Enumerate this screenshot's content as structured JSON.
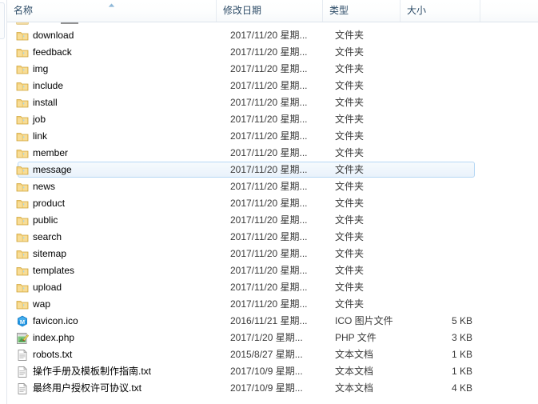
{
  "window": {
    "view_mode": "details-list"
  },
  "columns": [
    {
      "key": "name",
      "label": "名称",
      "sorted": true,
      "sort_direction": "ascending",
      "sort_icon": "sort-ascending-icon"
    },
    {
      "key": "date_modified",
      "label": "修改日期",
      "sorted": false
    },
    {
      "key": "type",
      "label": "类型",
      "sorted": false
    },
    {
      "key": "size",
      "label": "大小",
      "sorted": false
    }
  ],
  "items": [
    {
      "name": "download",
      "date": "2017/11/20 星期...",
      "type": "文件夹",
      "size": "",
      "icon": "folder-icon",
      "selected": false
    },
    {
      "name": "feedback",
      "date": "2017/11/20 星期...",
      "type": "文件夹",
      "size": "",
      "icon": "folder-icon",
      "selected": false
    },
    {
      "name": "img",
      "date": "2017/11/20 星期...",
      "type": "文件夹",
      "size": "",
      "icon": "folder-icon",
      "selected": false
    },
    {
      "name": "include",
      "date": "2017/11/20 星期...",
      "type": "文件夹",
      "size": "",
      "icon": "folder-icon",
      "selected": false
    },
    {
      "name": "install",
      "date": "2017/11/20 星期...",
      "type": "文件夹",
      "size": "",
      "icon": "folder-icon",
      "selected": false
    },
    {
      "name": "job",
      "date": "2017/11/20 星期...",
      "type": "文件夹",
      "size": "",
      "icon": "folder-icon",
      "selected": false
    },
    {
      "name": "link",
      "date": "2017/11/20 星期...",
      "type": "文件夹",
      "size": "",
      "icon": "folder-icon",
      "selected": false
    },
    {
      "name": "member",
      "date": "2017/11/20 星期...",
      "type": "文件夹",
      "size": "",
      "icon": "folder-icon",
      "selected": false
    },
    {
      "name": "message",
      "date": "2017/11/20 星期...",
      "type": "文件夹",
      "size": "",
      "icon": "folder-icon",
      "selected": true
    },
    {
      "name": "news",
      "date": "2017/11/20 星期...",
      "type": "文件夹",
      "size": "",
      "icon": "folder-icon",
      "selected": false
    },
    {
      "name": "product",
      "date": "2017/11/20 星期...",
      "type": "文件夹",
      "size": "",
      "icon": "folder-icon",
      "selected": false
    },
    {
      "name": "public",
      "date": "2017/11/20 星期...",
      "type": "文件夹",
      "size": "",
      "icon": "folder-icon",
      "selected": false
    },
    {
      "name": "search",
      "date": "2017/11/20 星期...",
      "type": "文件夹",
      "size": "",
      "icon": "folder-icon",
      "selected": false
    },
    {
      "name": "sitemap",
      "date": "2017/11/20 星期...",
      "type": "文件夹",
      "size": "",
      "icon": "folder-icon",
      "selected": false
    },
    {
      "name": "templates",
      "date": "2017/11/20 星期...",
      "type": "文件夹",
      "size": "",
      "icon": "folder-icon",
      "selected": false
    },
    {
      "name": "upload",
      "date": "2017/11/20 星期...",
      "type": "文件夹",
      "size": "",
      "icon": "folder-icon",
      "selected": false
    },
    {
      "name": "wap",
      "date": "2017/11/20 星期...",
      "type": "文件夹",
      "size": "",
      "icon": "folder-icon",
      "selected": false
    },
    {
      "name": "favicon.ico",
      "date": "2016/11/21 星期...",
      "type": "ICO 图片文件",
      "size": "5 KB",
      "icon": "ico-image-file-icon",
      "selected": false
    },
    {
      "name": "index.php",
      "date": "2017/1/20 星期...",
      "type": "PHP 文件",
      "size": "3 KB",
      "icon": "php-file-icon",
      "selected": false
    },
    {
      "name": "robots.txt",
      "date": "2015/8/27 星期...",
      "type": "文本文档",
      "size": "1 KB",
      "icon": "text-file-icon",
      "selected": false
    },
    {
      "name": "操作手册及模板制作指南.txt",
      "date": "2017/10/9 星期...",
      "type": "文本文档",
      "size": "1 KB",
      "icon": "text-file-icon",
      "selected": false
    },
    {
      "name": "最终用户授权许可协议.txt",
      "date": "2017/10/9 星期...",
      "type": "文本文档",
      "size": "4 KB",
      "icon": "text-file-icon",
      "selected": false
    }
  ],
  "colors": {
    "header_text": "#2b4a66",
    "header_border": "#dde4ec",
    "selection_border": "#b6d7f4",
    "selection_fill": "#e9f2fb",
    "folder_body": "#f0c661",
    "folder_edge": "#d3a93f",
    "ico_badge": "#2196e3",
    "text_file_page": "#ffffff",
    "row_text": "#000000"
  }
}
